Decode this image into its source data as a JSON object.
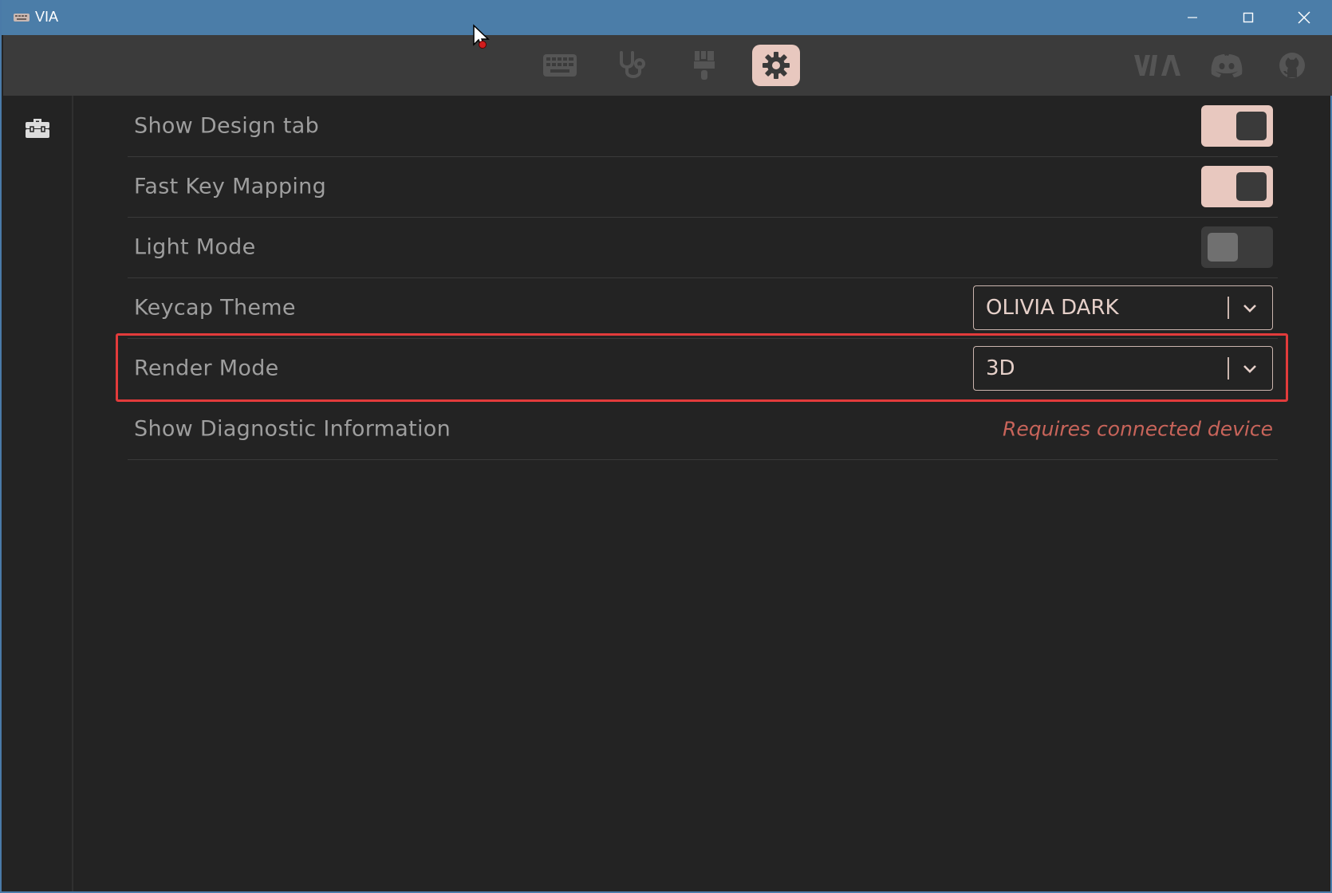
{
  "window": {
    "title": "VIA",
    "controls": [
      "minimize-icon",
      "maximize-icon",
      "close-icon"
    ]
  },
  "toolbar": {
    "tabs": [
      {
        "name": "keyboard-icon",
        "label": "Configure",
        "active": false
      },
      {
        "name": "stethoscope-icon",
        "label": "Key Tester",
        "active": false
      },
      {
        "name": "paintbrush-icon",
        "label": "Design",
        "active": false
      },
      {
        "name": "gear-icon",
        "label": "Settings",
        "active": true
      }
    ],
    "links": [
      "via-logo-icon",
      "discord-icon",
      "github-icon"
    ],
    "active_color": "#e8c8bf"
  },
  "sidebar": {
    "items": [
      {
        "name": "toolbox-icon",
        "active": true
      }
    ]
  },
  "settings": {
    "rows": [
      {
        "label": "Show Design tab",
        "control": "toggle",
        "value": true
      },
      {
        "label": "Fast Key Mapping",
        "control": "toggle",
        "value": true
      },
      {
        "label": "Light Mode",
        "control": "toggle",
        "value": false
      },
      {
        "label": "Keycap Theme",
        "control": "select",
        "value": "OLIVIA DARK"
      },
      {
        "label": "Render Mode",
        "control": "select",
        "value": "3D"
      },
      {
        "label": "Show Diagnostic Information",
        "control": "note",
        "value": "Requires connected device"
      }
    ]
  },
  "colors": {
    "titlebar": "#4b7da8",
    "toolbar": "#3b3b3b",
    "background": "#232323",
    "accent": "#e8c8bf",
    "label_text": "#9e9e9e",
    "warning_text": "#c8645a",
    "highlight": "#e23b3b"
  }
}
